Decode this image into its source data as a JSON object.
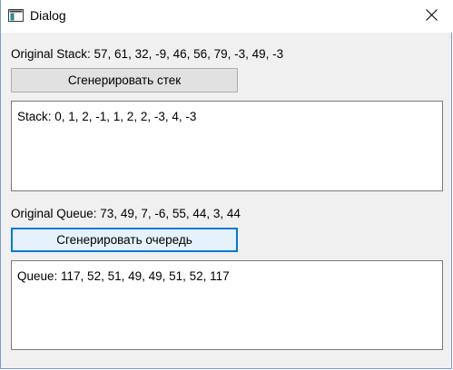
{
  "window": {
    "title": "Dialog",
    "close_icon": "close-icon",
    "app_icon": "dialog-app-icon"
  },
  "stack": {
    "original_label": "Original Stack: 57, 61, 32, -9, 46, 56, 79, -3, 49, -3",
    "generate_button": "Сгенерировать стек",
    "output": "Stack: 0, 1, 2, -1, 1, 2, 2, -3, 4, -3"
  },
  "queue": {
    "original_label": "Original Queue: 73, 49, 7, -6, 55, 44, 3, 44",
    "generate_button": "Сгенерировать очередь",
    "output": "Queue: 117, 52, 51, 49, 49, 51, 52, 117"
  },
  "colors": {
    "focus_border": "#0078d7",
    "dialog_background": "#f0f0f0",
    "button_background": "#e1e1e1"
  }
}
